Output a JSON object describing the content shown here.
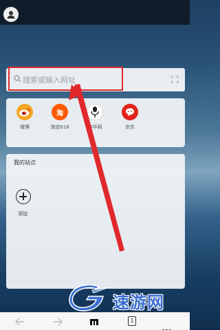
{
  "search": {
    "placeholder": "搜索或输入网址"
  },
  "quick_links": [
    {
      "label": "微博",
      "icon": "weibo-icon",
      "color": "#f4a626"
    },
    {
      "label": "淘宝618",
      "icon": "taobao-icon",
      "color": "#ff5a00",
      "glyph": "淘"
    },
    {
      "label": "中华网",
      "icon": "china-com-icon",
      "color": "#ffffff"
    },
    {
      "label": "京东",
      "icon": "jd-icon",
      "color": "#e2231a"
    }
  ],
  "my_sites": {
    "title": "我的站点",
    "add_label": "添加"
  },
  "toolbar": {
    "tab_count": "1"
  },
  "watermark": {
    "text": "速游网"
  },
  "colors": {
    "highlight": "#e0292c",
    "watermark": "#3b6fd0"
  }
}
